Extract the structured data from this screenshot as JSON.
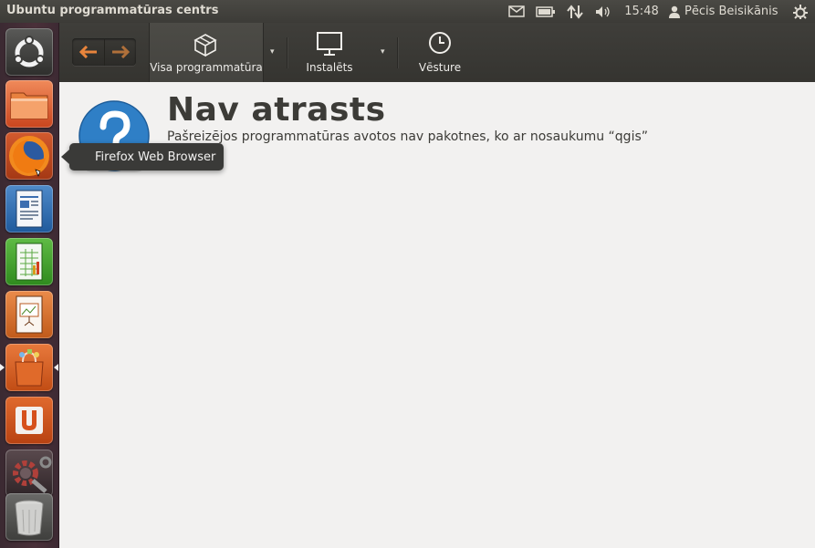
{
  "panel": {
    "window_title": "Ubuntu programmatūras centrs",
    "clock": "15:48",
    "user_name": "Pēcis Beisikānis",
    "icons": [
      "mail-icon",
      "battery-icon",
      "network-icon",
      "volume-icon",
      "user-icon",
      "session-gear-icon"
    ]
  },
  "launcher": {
    "items": [
      {
        "name": "dash-home",
        "icon": "ubuntu-logo-icon"
      },
      {
        "name": "files",
        "icon": "folder-icon"
      },
      {
        "name": "firefox",
        "icon": "firefox-icon"
      },
      {
        "name": "writer",
        "icon": "writer-document-icon"
      },
      {
        "name": "calc",
        "icon": "calc-spreadsheet-icon"
      },
      {
        "name": "impress",
        "icon": "impress-presentation-icon"
      },
      {
        "name": "software-center",
        "icon": "shopping-bag-icon"
      },
      {
        "name": "ubuntu-one",
        "icon": "ubuntu-one-icon"
      },
      {
        "name": "system-settings",
        "icon": "settings-gears-icon"
      },
      {
        "name": "trash",
        "icon": "trash-icon"
      }
    ]
  },
  "toolbar": {
    "back_icon": "back-arrow-icon",
    "forward_icon": "forward-arrow-icon",
    "all_software_label": "Visa programmatūra",
    "installed_label": "Instalēts",
    "history_label": "Vēsture"
  },
  "content": {
    "heading": "Nav atrasts",
    "message": "Pašreizējos programmatūras avotos nav pakotnes, ko ar nosaukumu “qgis”"
  },
  "tooltip": {
    "text": "Firefox Web Browser"
  },
  "colors": {
    "panel_bg": "#3c3b37",
    "launcher_bg": "#4a3039",
    "content_bg": "#f2f1f0",
    "accent_orange": "#e86c3c"
  }
}
